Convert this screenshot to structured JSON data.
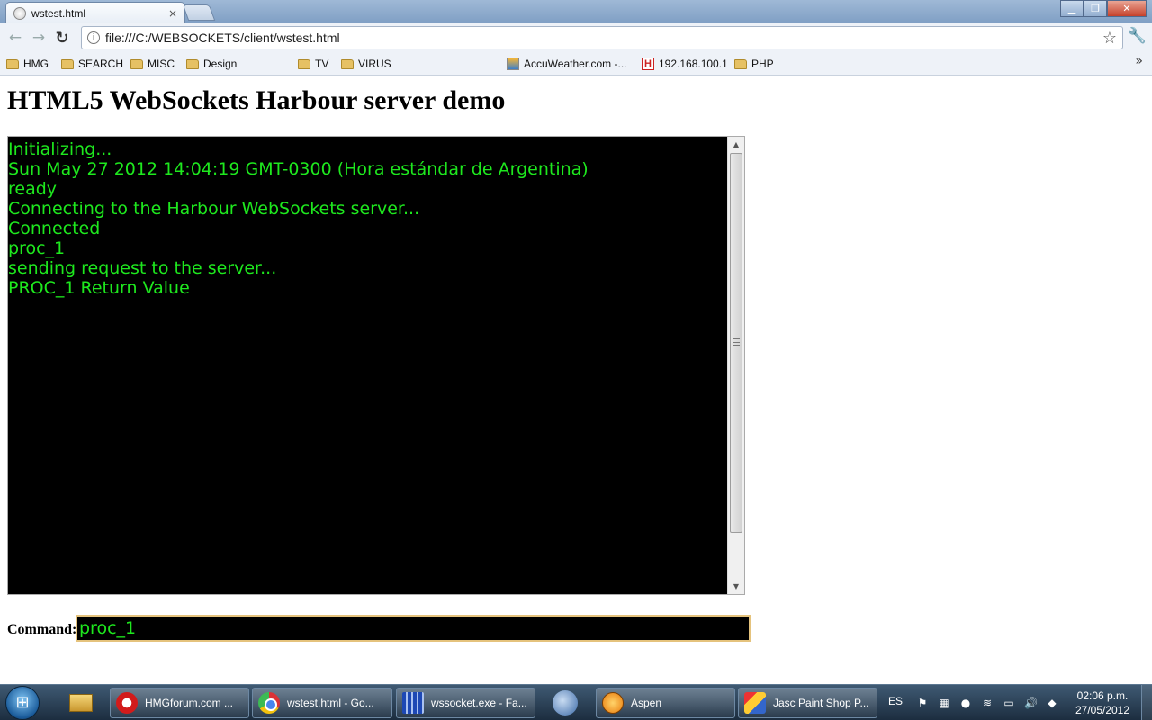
{
  "browser": {
    "tab_title": "wstest.html",
    "tab_close": "×",
    "url": "file:///C:/WEBSOCKETS/client/wstest.html"
  },
  "bookmarks": [
    {
      "label": "HMG",
      "icon": "folder-icon"
    },
    {
      "label": "SEARCH",
      "icon": "folder-icon"
    },
    {
      "label": "MISC",
      "icon": "folder-icon"
    },
    {
      "label": "Design",
      "icon": "folder-icon"
    },
    {
      "label": "TV",
      "icon": "folder-icon"
    },
    {
      "label": "VIRUS",
      "icon": "folder-icon"
    },
    {
      "label": "AccuWeather.com -...",
      "icon": "accuweather-icon"
    },
    {
      "label": "192.168.100.1",
      "icon": "router-icon"
    },
    {
      "label": "PHP",
      "icon": "folder-icon"
    }
  ],
  "page": {
    "title": "HTML5 WebSockets Harbour server demo",
    "console_lines": [
      "Initializing...",
      "Sun May 27 2012 14:04:19 GMT-0300 (Hora estándar de Argentina)",
      "ready",
      "Connecting to the Harbour WebSockets server...",
      "Connected",
      "proc_1",
      "sending request to the server...",
      "PROC_1 Return Value"
    ],
    "command_label": "Command:",
    "command_value": "proc_1"
  },
  "taskbar": {
    "tasks": [
      {
        "label": "HMGforum.com ...",
        "icon": "opera-icon"
      },
      {
        "label": "wstest.html - Go...",
        "icon": "chrome-icon"
      },
      {
        "label": "wssocket.exe - Fa...",
        "icon": "wssocket-icon"
      },
      {
        "label": "Aspen",
        "icon": "aspen-icon"
      },
      {
        "label": "Jasc Paint Shop P...",
        "icon": "paintshop-icon"
      }
    ],
    "language": "ES",
    "time": "02:06 p.m.",
    "date": "27/05/2012"
  },
  "colors": {
    "console_bg": "#000000",
    "console_text": "#1ee81e",
    "input_border": "#e5c37d"
  }
}
